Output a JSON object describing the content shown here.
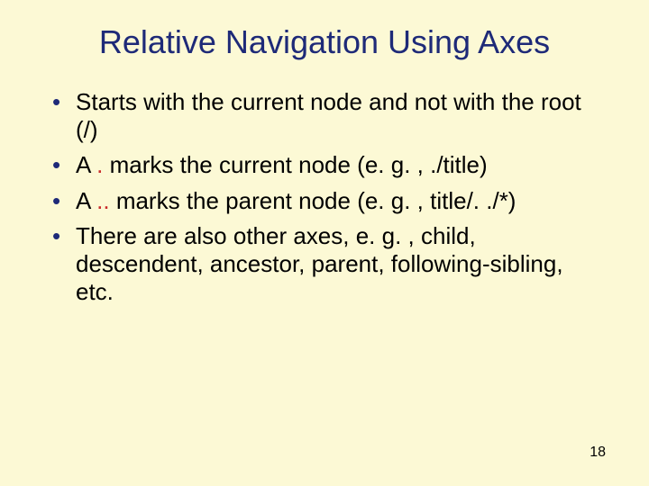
{
  "title": "Relative Navigation Using Axes",
  "bullets": {
    "b1": "Starts with the current node and not with the root (/)",
    "b2": {
      "pre": "A ",
      "red": ".",
      "post": " marks the current node (e. g. , ./title)"
    },
    "b3": {
      "pre": "A ",
      "red": "..",
      "post": " marks the parent node (e. g. , title/. ./*)"
    },
    "b4": "There are also other axes, e. g. , child, descendent, ancestor, parent, following-sibling, etc."
  },
  "page_number": "18"
}
